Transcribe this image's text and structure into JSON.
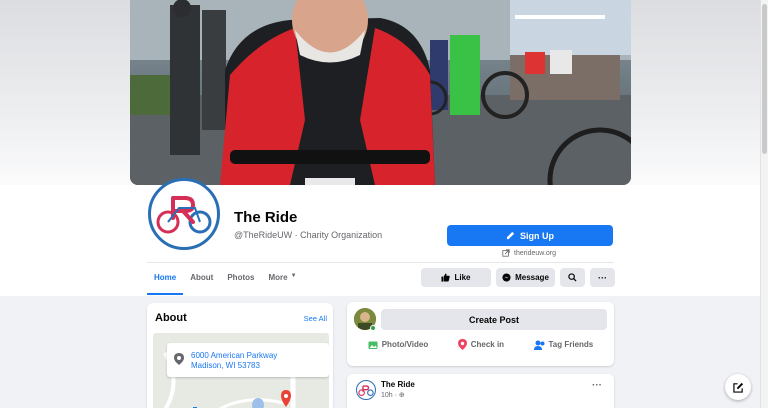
{
  "page": {
    "name": "The Ride",
    "subtitle": "@TheRideUW · Charity Organization",
    "signup_label": "Sign Up",
    "website": "therideuw.org"
  },
  "tabs": [
    {
      "label": "Home",
      "active": true
    },
    {
      "label": "About",
      "active": false
    },
    {
      "label": "Photos",
      "active": false
    },
    {
      "label": "More",
      "active": false
    }
  ],
  "actions": {
    "like_label": "Like",
    "message_label": "Message",
    "search_icon": "search-icon",
    "more_icon": "ellipsis-icon"
  },
  "about": {
    "title": "About",
    "see_all": "See All",
    "address_line1": "6000 American Parkway",
    "address_line2": "Madison, WI 53783"
  },
  "composer": {
    "create_post_label": "Create Post",
    "photo_video_label": "Photo/Video",
    "check_in_label": "Check in",
    "tag_friends_label": "Tag Friends"
  },
  "post": {
    "author": "The Ride",
    "time": "10h · ",
    "more": "···"
  },
  "colors": {
    "primary": "#1877f2",
    "logo_red": "#d62f57",
    "logo_blue": "#2a6fb6"
  }
}
